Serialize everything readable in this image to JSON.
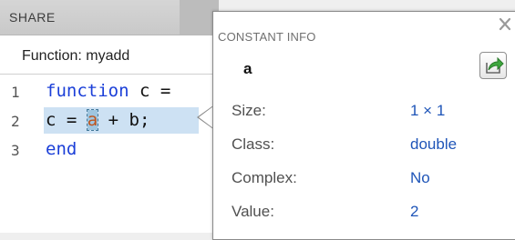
{
  "editor": {
    "panel_title": "SHARE",
    "function_label": "Function: myadd",
    "lines": [
      {
        "number": "1",
        "keyword": "function",
        "rest": " c ="
      },
      {
        "number": "2",
        "before": "c = ",
        "variable": "a",
        "after": " + b;"
      },
      {
        "number": "3",
        "keyword": "end"
      }
    ]
  },
  "popup": {
    "title": "CONSTANT INFO",
    "variable_name": "a",
    "close_icon": "close-icon",
    "export_icon": "export-arrow-icon",
    "properties": [
      {
        "label": "Size:",
        "value": "1 × 1"
      },
      {
        "label": "Class:",
        "value": "double"
      },
      {
        "label": "Complex:",
        "value": "No"
      },
      {
        "label": "Value:",
        "value": "2"
      }
    ]
  },
  "colors": {
    "keyword": "#1b3fd8",
    "variable": "#c0541c",
    "highlight": "#cde1f3",
    "value_text": "#1f55b8"
  }
}
